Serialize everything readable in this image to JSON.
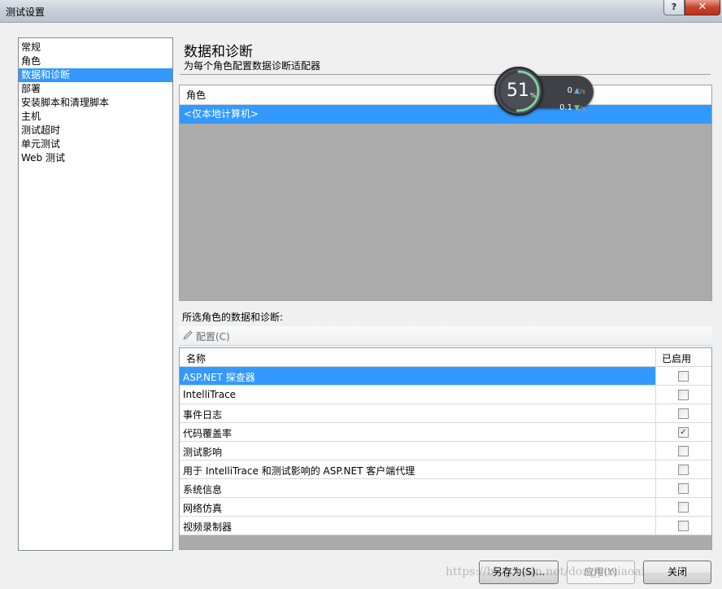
{
  "window": {
    "title": "测试设置",
    "help_glyph": "?",
    "close_glyph": "✕"
  },
  "nav": {
    "items": [
      {
        "label": "常规"
      },
      {
        "label": "角色"
      },
      {
        "label": "数据和诊断",
        "selected": true
      },
      {
        "label": "部署"
      },
      {
        "label": "安装脚本和清理脚本"
      },
      {
        "label": "主机"
      },
      {
        "label": "测试超时"
      },
      {
        "label": "单元测试"
      },
      {
        "label": "Web 测试"
      }
    ]
  },
  "header": {
    "title": "数据和诊断",
    "subtitle": "为每个角色配置数据诊断适配器"
  },
  "roles": {
    "column_header": "角色",
    "rows": [
      "<仅本地计算机>"
    ],
    "selected_color": "#3399ff"
  },
  "network_widget": {
    "percent": "51",
    "percent_unit": "%",
    "percent_value": 51,
    "upload": "0",
    "upload_unit": "K/s",
    "download": "0.1",
    "download_unit": "K/s",
    "up_icon": "up-arrow-icon",
    "down_icon": "down-arrow-icon"
  },
  "diagnostics": {
    "section_label": "所选角色的数据和诊断:",
    "configure_label": "配置(C)",
    "configure_icon": "pencil-icon",
    "columns": {
      "name": "名称",
      "enabled": "已启用"
    },
    "adapters": [
      {
        "name": "ASP.NET 探查器",
        "enabled": false,
        "selected": true
      },
      {
        "name": "IntelliTrace",
        "enabled": false
      },
      {
        "name": "事件日志",
        "enabled": false
      },
      {
        "name": "代码覆盖率",
        "enabled": true
      },
      {
        "name": "测试影响",
        "enabled": false
      },
      {
        "name": "用于 IntelliTrace 和测试影响的 ASP.NET 客户端代理",
        "enabled": false
      },
      {
        "name": "系统信息",
        "enabled": false
      },
      {
        "name": "网络仿真",
        "enabled": false
      },
      {
        "name": "视频录制器",
        "enabled": false
      }
    ]
  },
  "buttons": {
    "save_as": "另存为(S)...",
    "apply": "应用(Y)",
    "close": "关闭"
  },
  "watermark": "https://blog.csdn.net/dongyuxiaoai"
}
